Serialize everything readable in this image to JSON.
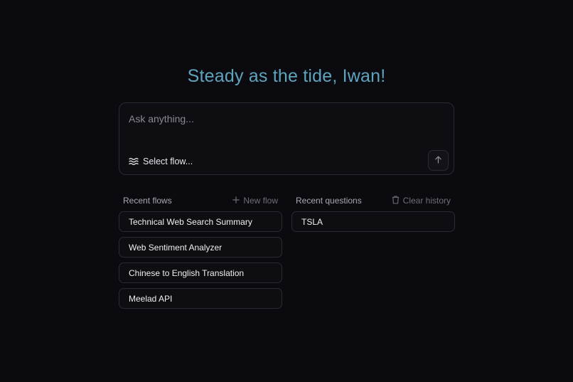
{
  "greeting": "Steady as the tide, Iwan!",
  "ask": {
    "placeholder": "Ask anything...",
    "value": "",
    "select_flow_label": "Select flow...",
    "select_flow_icon": "waves-icon",
    "send_icon": "arrow-up-icon"
  },
  "recent_flows": {
    "title": "Recent flows",
    "action_label": "New flow",
    "action_icon": "plus-icon",
    "items": [
      {
        "label": "Technical Web Search Summary"
      },
      {
        "label": "Web Sentiment Analyzer"
      },
      {
        "label": "Chinese to English Translation"
      },
      {
        "label": "Meelad API"
      }
    ]
  },
  "recent_questions": {
    "title": "Recent questions",
    "action_label": "Clear history",
    "action_icon": "trash-icon",
    "items": [
      {
        "label": "TSLA"
      }
    ]
  },
  "colors": {
    "background": "#0b0b0f",
    "greeting": "#5fa4bf",
    "border": "#2b2b32",
    "muted": "#6e6e76"
  }
}
